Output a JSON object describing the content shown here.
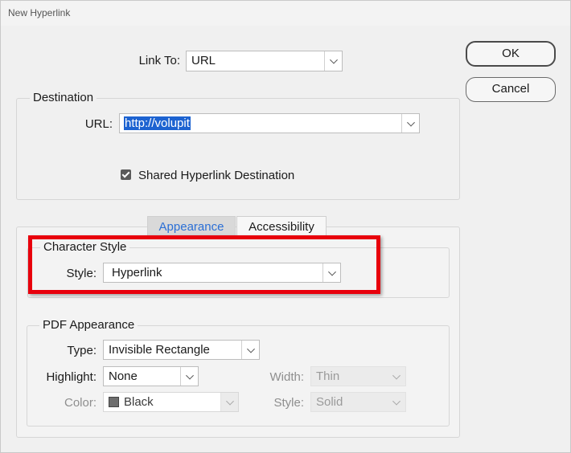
{
  "window": {
    "title": "New Hyperlink"
  },
  "link_to": {
    "label": "Link To:",
    "value": "URL"
  },
  "buttons": {
    "ok": "OK",
    "cancel": "Cancel"
  },
  "destination": {
    "title": "Destination",
    "url_label": "URL:",
    "url_value": "http://volupit",
    "shared_label": "Shared Hyperlink Destination",
    "shared_checked": true
  },
  "tabs": [
    {
      "label": "Appearance",
      "active": true
    },
    {
      "label": "Accessibility",
      "active": false
    }
  ],
  "character_style": {
    "title": "Character Style",
    "style_label": "Style:",
    "style_value": "Hyperlink"
  },
  "pdf_appearance": {
    "title": "PDF Appearance",
    "type_label": "Type:",
    "type_value": "Invisible Rectangle",
    "highlight_label": "Highlight:",
    "highlight_value": "None",
    "width_label": "Width:",
    "width_value": "Thin",
    "color_label": "Color:",
    "color_value": "Black",
    "style_label": "Style:",
    "style_value": "Solid"
  },
  "colors": {
    "accent": "#2b6fd6",
    "annotation_red": "#e8000c",
    "selection": "#1d63d1"
  }
}
